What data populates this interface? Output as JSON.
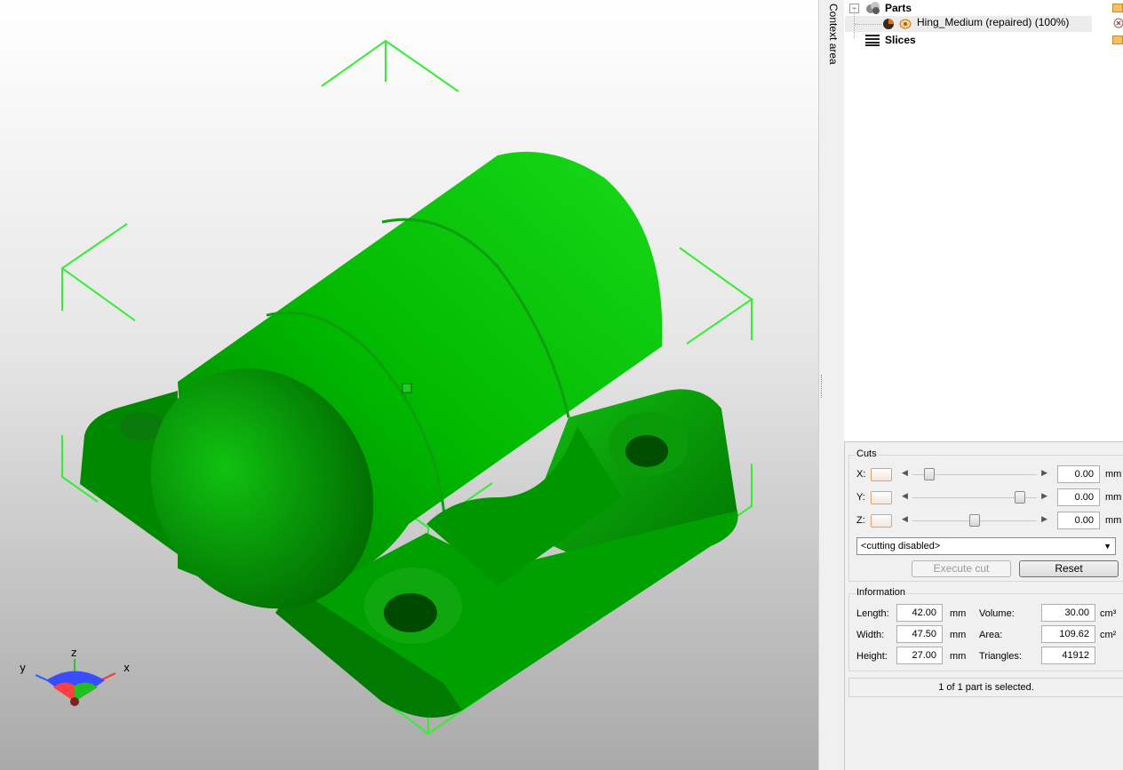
{
  "viewport": {
    "model_name": "3d-model-hinge",
    "model_color": "#00c800",
    "frame_color": "#33ee33",
    "axes": {
      "x": "x",
      "y": "y",
      "z": "z"
    }
  },
  "context_tab": {
    "label": "Context area"
  },
  "tree": {
    "parts": {
      "label": "Parts",
      "expander": "−"
    },
    "part_item": {
      "label": "Hing_Medium (repaired) (100%)"
    },
    "slices": {
      "label": "Slices"
    }
  },
  "cuts": {
    "title": "Cuts",
    "rows": [
      {
        "axis": "X:",
        "value": "0.00",
        "unit": "mm",
        "slider_fraction": 0.1
      },
      {
        "axis": "Y:",
        "value": "0.00",
        "unit": "mm",
        "slider_fraction": 0.9
      },
      {
        "axis": "Z:",
        "value": "0.00",
        "unit": "mm",
        "slider_fraction": 0.5
      }
    ],
    "mode": "<cutting disabled>",
    "execute_label": "Execute cut",
    "reset_label": "Reset"
  },
  "info": {
    "title": "Information",
    "length": {
      "label": "Length:",
      "value": "42.00",
      "unit": "mm"
    },
    "width": {
      "label": "Width:",
      "value": "47.50",
      "unit": "mm"
    },
    "height": {
      "label": "Height:",
      "value": "27.00",
      "unit": "mm"
    },
    "volume": {
      "label": "Volume:",
      "value": "30.00",
      "unit": "cm³"
    },
    "area": {
      "label": "Area:",
      "value": "109.62",
      "unit": "cm²"
    },
    "triangles": {
      "label": "Triangles:",
      "value": "41912"
    }
  },
  "status": {
    "text": "1 of 1 part is selected."
  }
}
